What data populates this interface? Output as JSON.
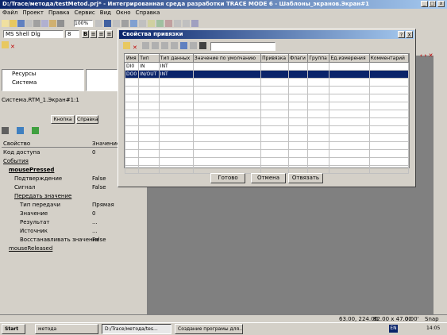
{
  "app": {
    "title": "D:/Trace/метода/testMetod.prj* - Интегрированная среда разработки TRACE MODE 6 - Шаблоны_экранов.Экран#1",
    "menu": [
      "Файл",
      "Проект",
      "Правка",
      "Сервис",
      "Вид",
      "Окно",
      "Справка"
    ],
    "font_name": "MS Shell Dlg",
    "font_size": "8",
    "zoom": "100%"
  },
  "tree": {
    "items": [
      "Ресурсы",
      "Система"
    ],
    "path": "Система.RTM_1.Экран#1:1"
  },
  "props": {
    "tab_button": "Кнопка",
    "tab_help": "Справка",
    "col_property": "Свойство",
    "col_value": "Значение",
    "rows": [
      {
        "label": "Код доступа",
        "value": "0",
        "indent": 0,
        "bold": false
      },
      {
        "label": "События",
        "value": "",
        "indent": 0,
        "bold": false,
        "link": true
      },
      {
        "label": "mousePressed",
        "value": "",
        "indent": 1,
        "bold": true,
        "link": true
      },
      {
        "label": "Подтверждение",
        "value": "False",
        "indent": 2,
        "bold": false
      },
      {
        "label": "Сигнал",
        "value": "False",
        "indent": 2,
        "bold": false
      },
      {
        "label": "Передать значение",
        "value": "",
        "indent": 2,
        "bold": false,
        "link": true
      },
      {
        "label": "Тип передачи",
        "value": "Прямая",
        "indent": 3,
        "bold": false
      },
      {
        "label": "Значение",
        "value": "0",
        "indent": 3,
        "bold": false
      },
      {
        "label": "Результат",
        "value": "...",
        "indent": 3,
        "bold": false
      },
      {
        "label": "Источник",
        "value": "...",
        "indent": 3,
        "bold": false
      },
      {
        "label": "Восстанавливать значение",
        "value": "False",
        "indent": 3,
        "bold": false
      },
      {
        "label": "mouseReleased",
        "value": "",
        "indent": 1,
        "bold": false,
        "link": true
      }
    ]
  },
  "dialog": {
    "title": "Свойства привязки",
    "help": "?",
    "close": "X",
    "columns": [
      "Имя",
      "Тип",
      "Тип данных",
      "Значение по умолчанию",
      "Привязка",
      "Флаги",
      "Группа",
      "Ед.измерения",
      "Комментарий"
    ],
    "rows": [
      {
        "name": "DI0",
        "type": "IN",
        "dtype": "INT",
        "selected": false
      },
      {
        "name": "DO0",
        "type": "IN/OUT",
        "dtype": "INT",
        "selected": true
      }
    ],
    "ok": "Готово",
    "cancel": "Отмена",
    "unbind": "Отвязать"
  },
  "status": {
    "coords": "63.00, 224.00",
    "size": "82.00 x 47.00",
    "angle": "0.00'",
    "snap": "Snap OFF"
  },
  "taskbar": {
    "start": "Start",
    "items": [
      "метода",
      "D:/Trace/метода/tes...",
      "Создание програмы для..."
    ],
    "lang": "EN",
    "time": "14:05"
  }
}
